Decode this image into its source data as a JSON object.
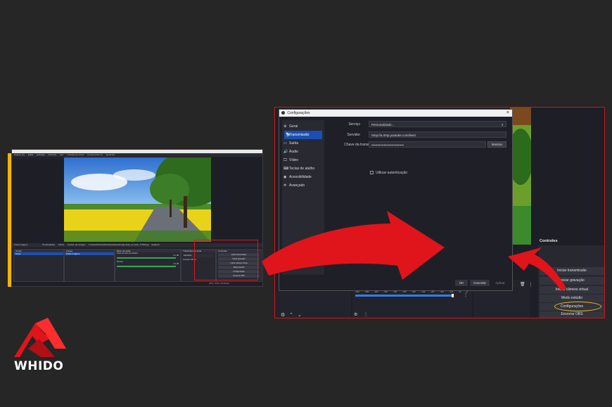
{
  "left_screenshot": {
    "window_title": "OBS 27.2.4 (64-bit, windows) - Perfil: Sem título - Cenas: Sem título",
    "menu": [
      "Arquivo (F)",
      "Editar",
      "Exibição",
      "Perfil (P)",
      "Ferr",
      "Coleção de cenas",
      "Ferramentas (T)",
      "Ajuda (H)"
    ],
    "source_bar": {
      "name": "Fonte Imagem",
      "properties": "Propriedades",
      "filters": "Filtros",
      "file_label": "Arquivo de imagem",
      "file_path": "C:/Users/Pichau/Desktop/alpaca/image-field_of_fresh_77546.jpg",
      "browse": "Explorar"
    },
    "scenes": {
      "title": "Cenas",
      "items": [
        "Cena"
      ]
    },
    "sources": {
      "title": "Fontes",
      "items": [
        "Fonte Imagem"
      ]
    },
    "mixer": {
      "title": "Mixer de áudio",
      "channels": [
        "Áudio da Área de trabalho",
        "Mic/Aux"
      ],
      "levels": [
        "0.0 dB",
        "0.0 dB"
      ]
    },
    "transitions": {
      "title": "Transições de cena",
      "type": "Esmaecer",
      "duration_label": "Duração",
      "duration": "300 ms"
    },
    "controls": {
      "title": "Controles",
      "buttons": [
        "Iniciar transmissão",
        "Iniciar gravação",
        "Iniciar câmera virtual",
        "Modo estúdio",
        "Configurações",
        "Encerrar OBS"
      ]
    },
    "status": "CPU: 0.6%, 30.00 fps"
  },
  "dialog": {
    "title": "Configurações",
    "close": "×",
    "sidebar": [
      {
        "label": "Geral",
        "icon": "gear-icon",
        "glyph": "⚙"
      },
      {
        "label": "Transmissão",
        "icon": "broadcast-icon",
        "glyph": "📡"
      },
      {
        "label": "Saída",
        "icon": "output-icon",
        "glyph": "▭"
      },
      {
        "label": "Áudio",
        "icon": "speaker-icon",
        "glyph": "🔊"
      },
      {
        "label": "Vídeo",
        "icon": "monitor-icon",
        "glyph": "🖵"
      },
      {
        "label": "Teclas de atalho",
        "icon": "keyboard-icon",
        "glyph": "⌨"
      },
      {
        "label": "Acessibilidade",
        "icon": "accessibility-icon",
        "glyph": "◉"
      },
      {
        "label": "Avançado",
        "icon": "wrench-icon",
        "glyph": "✲"
      }
    ],
    "selected_index": 1,
    "service_label": "Serviço",
    "service_value": "Personalizado...",
    "server_label": "Servidor",
    "server_value": "rtmp://a.rtmp.youtube.com/live2",
    "key_label": "Chave da transmissão",
    "key_value": "••••••••••••••••••••••••••",
    "show_button": "Mostrar",
    "auth_label": "Utilizar autenticação",
    "ok": "OK",
    "cancel": "Cancelar",
    "apply": "Aplicar"
  },
  "right_panel": {
    "controls_title": "Controles",
    "buttons": [
      "Iniciar transmissão",
      "Iniciar gravação",
      "Iniciar câmera virtual",
      "Modo estúdio",
      "Configurações",
      "Encerrar OBS"
    ],
    "highlighted": "Configurações",
    "meter_ticks": [
      "-60",
      "-55",
      "-50",
      "-45",
      "-40",
      "-35",
      "-30",
      "-25",
      "-20",
      "-15",
      "-10",
      "-5",
      "0"
    ]
  },
  "logo": {
    "text": "WHIDO"
  },
  "colors": {
    "accent_red": "#e0141b",
    "selection_blue": "#1b4fb3",
    "frame_yellow": "#f2b400",
    "highlight_yellow": "#f0c020"
  }
}
